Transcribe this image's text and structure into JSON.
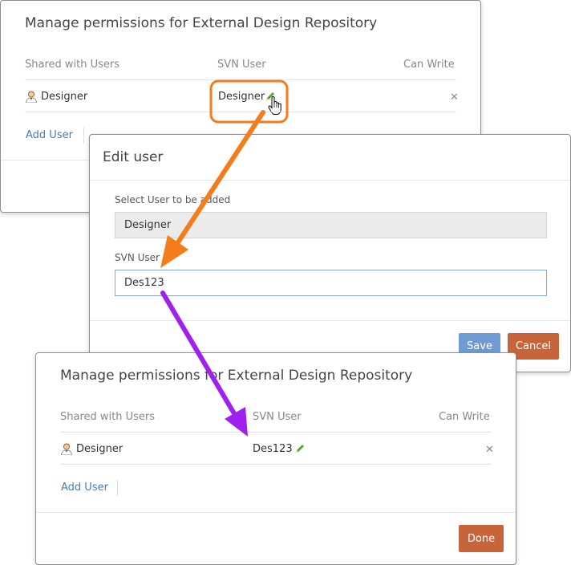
{
  "dialog_top": {
    "title": "Manage permissions for External Design Repository",
    "columns": [
      "Shared with Users",
      "SVN User",
      "Can Write"
    ],
    "row": {
      "user": "Designer",
      "svn_user": "Designer"
    },
    "add_user_label": "Add User"
  },
  "edit_dialog": {
    "title": "Edit user",
    "select_label": "Select User to be added",
    "select_value": "Designer",
    "svn_label": "SVN User",
    "svn_value": "Des123",
    "save_label": "Save",
    "cancel_label": "Cancel"
  },
  "dialog_bottom": {
    "title": "Manage permissions for External Design Repository",
    "columns": [
      "Shared with Users",
      "SVN User",
      "Can Write"
    ],
    "row": {
      "user": "Designer",
      "svn_user": "Des123"
    },
    "add_user_label": "Add User",
    "done_label": "Done"
  },
  "colors": {
    "link": "#4a7cb0",
    "save": "#6f9bd2",
    "cancel": "#c8643a",
    "done": "#c8643a",
    "arrow_orange": "#f47c1a",
    "arrow_purple": "#a020f0",
    "edit_pencil": "#5aa02c"
  }
}
